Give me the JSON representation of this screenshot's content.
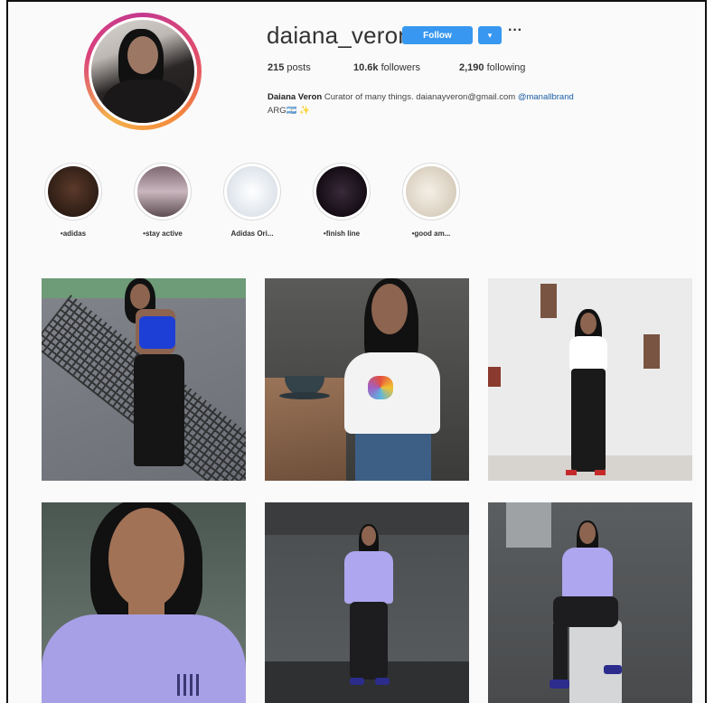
{
  "profile": {
    "username": "daiana_veron",
    "follow_label": "Follow",
    "dropdown_label": "▾",
    "more_label": "···",
    "stats": {
      "posts": "215",
      "posts_label": "posts",
      "followers": "10.6k",
      "followers_label": "followers",
      "following": "2,190",
      "following_label": "following"
    },
    "bio": {
      "name": "Daiana Veron",
      "text": "Curator of many things. daianayveron@gmail.com",
      "mention": "@manallbrand",
      "line2": "ARG🇦🇷 ✨"
    }
  },
  "highlights": [
    {
      "label": "•adidas"
    },
    {
      "label": "•stay active"
    },
    {
      "label": "Adidas Ori..."
    },
    {
      "label": "•finish line"
    },
    {
      "label": "•good am..."
    }
  ],
  "posts": [
    {
      "icon": "tennis-net-photo"
    },
    {
      "icon": "coffee-table-photo"
    },
    {
      "icon": "white-wall-photo"
    },
    {
      "icon": "selfie-photo"
    },
    {
      "icon": "warehouse-photo"
    },
    {
      "icon": "sitting-photo"
    }
  ],
  "colors": {
    "accent": "#3897f0",
    "link": "#1b5ea3",
    "ring": "#d9407d"
  }
}
